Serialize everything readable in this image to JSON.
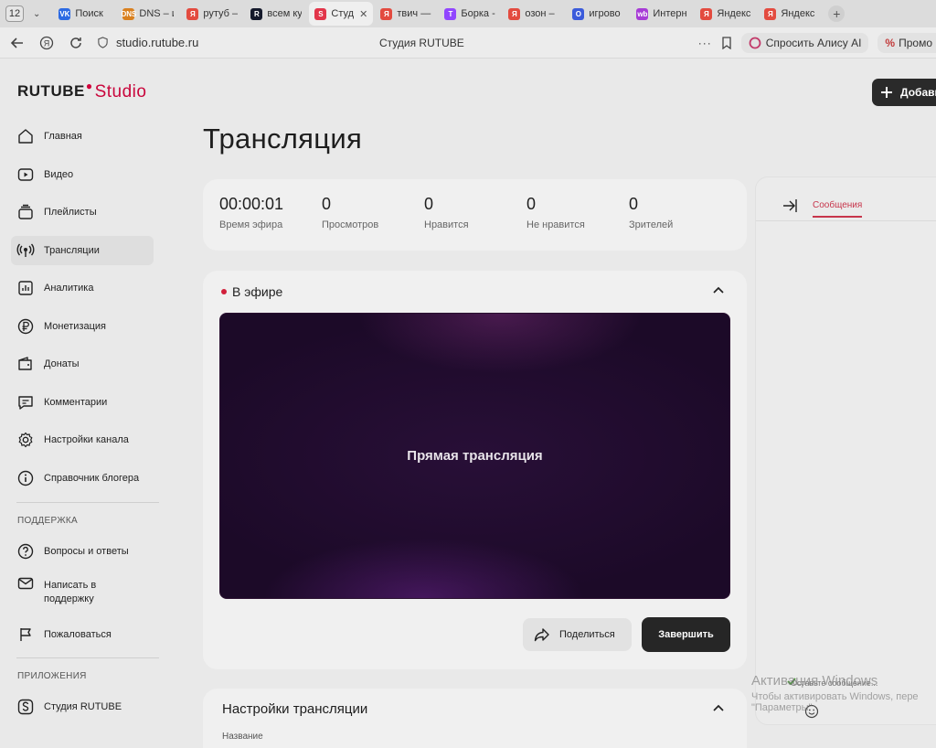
{
  "browser": {
    "tab_count": "12",
    "tabs": [
      {
        "label": "Поиск",
        "color": "#2c6ae3",
        "glyph": "VK"
      },
      {
        "label": "DNS – и",
        "color": "#d9801f",
        "glyph": "DNS"
      },
      {
        "label": "рутуб –",
        "color": "#e34b3f",
        "glyph": "Я"
      },
      {
        "label": "всем ку",
        "color": "#14192b",
        "glyph": "R"
      },
      {
        "label": "Студ",
        "color": "#e2354a",
        "glyph": "S"
      },
      {
        "label": "твич —",
        "color": "#e34b3f",
        "glyph": "Я"
      },
      {
        "label": "Борка -",
        "color": "#9146ff",
        "glyph": "T"
      },
      {
        "label": "озон –",
        "color": "#e34b3f",
        "glyph": "Я"
      },
      {
        "label": "игрово",
        "color": "#3b5bdb",
        "glyph": "O"
      },
      {
        "label": "Интерн",
        "color": "#a73bd6",
        "glyph": "wb"
      },
      {
        "label": "Яндекс",
        "color": "#e34b3f",
        "glyph": "Я"
      },
      {
        "label": "Яндекс",
        "color": "#e34b3f",
        "glyph": "Я"
      }
    ],
    "active_tab_index": 4,
    "url": "studio.rutube.ru",
    "page_title": "Студия RUTUBE",
    "alice_label": "Спросить Алису AI",
    "promo_label": "Промо"
  },
  "logo": {
    "brand": "RUTUBE",
    "product": "Studio"
  },
  "sidebar": {
    "items": [
      {
        "label": "Главная",
        "icon": "home-icon"
      },
      {
        "label": "Видео",
        "icon": "video-icon"
      },
      {
        "label": "Плейлисты",
        "icon": "playlist-icon"
      },
      {
        "label": "Трансляции",
        "icon": "broadcast-icon",
        "active": true
      },
      {
        "label": "Аналитика",
        "icon": "analytics-icon"
      },
      {
        "label": "Монетизация",
        "icon": "ruble-icon"
      },
      {
        "label": "Донаты",
        "icon": "wallet-icon"
      },
      {
        "label": "Комментарии",
        "icon": "comment-icon"
      },
      {
        "label": "Настройки канала",
        "icon": "gear-icon"
      },
      {
        "label": "Справочник блогера",
        "icon": "info-icon"
      }
    ],
    "support_heading": "ПОДДЕРЖКА",
    "support_items": [
      {
        "label": "Вопросы и ответы",
        "icon": "question-icon"
      },
      {
        "label": "Написать в поддержку",
        "icon": "mail-icon"
      },
      {
        "label": "Пожаловаться",
        "icon": "flag-icon"
      }
    ],
    "apps_heading": "ПРИЛОЖЕНИЯ",
    "apps_items": [
      {
        "label": "Студия RUTUBE",
        "icon": "studio-app-icon"
      }
    ]
  },
  "header": {
    "add_label": "Добави"
  },
  "page": {
    "title": "Трансляция"
  },
  "stats": [
    {
      "value": "00:00:01",
      "label": "Время эфира"
    },
    {
      "value": "0",
      "label": "Просмотров"
    },
    {
      "value": "0",
      "label": "Нравится"
    },
    {
      "value": "0",
      "label": "Не нравится"
    },
    {
      "value": "0",
      "label": "Зрителей"
    }
  ],
  "live": {
    "heading": "В эфире",
    "player_text": "Прямая трансляция",
    "share_label": "Поделиться",
    "end_label": "Завершить"
  },
  "settings": {
    "title": "Настройки трансляции",
    "field_label": "Название"
  },
  "chat": {
    "tab_label": "Сообщения",
    "input_placeholder": "Оставьте сообщение..."
  },
  "watermark": {
    "line1": "Активация Windows",
    "line2": "Чтобы активировать Windows, пере",
    "line3": "\"Параметры\"."
  }
}
